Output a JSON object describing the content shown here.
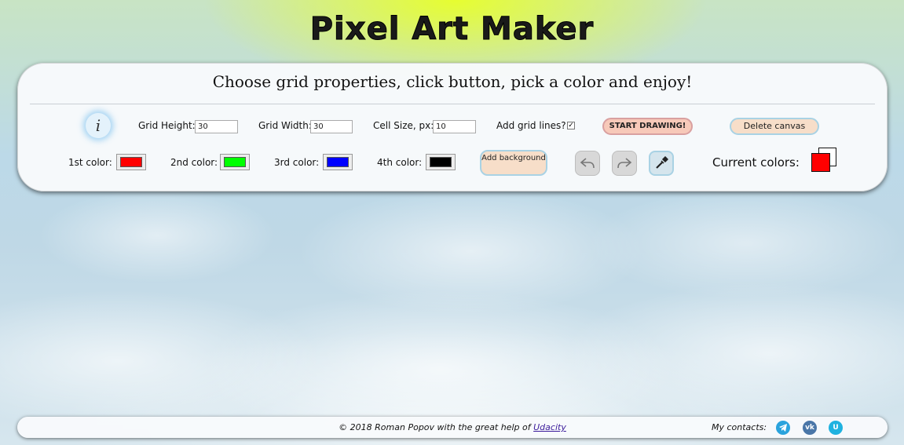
{
  "app": {
    "title": "Pixel Art Maker"
  },
  "panel": {
    "subtitle": "Choose grid properties, click button, pick a color and enjoy!",
    "info_icon": "info-icon",
    "grid_height": {
      "label": "Grid Height:",
      "value": "30"
    },
    "grid_width": {
      "label": "Grid Width:",
      "value": "30"
    },
    "cell_size": {
      "label": "Cell Size, px:",
      "value": "10"
    },
    "grid_lines": {
      "label": "Add grid lines?",
      "checked": true
    },
    "start_label": "START DRAWING!",
    "delete_label": "Delete canvas",
    "colors": [
      {
        "label": "1st color:",
        "value": "#ff0000"
      },
      {
        "label": "2nd color:",
        "value": "#00ff00"
      },
      {
        "label": "3rd color:",
        "value": "#0000ff"
      },
      {
        "label": "4th color:",
        "value": "#000000"
      }
    ],
    "add_background_label": "Add background",
    "undo_icon": "undo-icon",
    "redo_icon": "redo-icon",
    "eyedropper_icon": "eyedropper-icon",
    "current_colors_label": "Current colors:",
    "current_colors": {
      "primary": "#ff0000",
      "secondary": "#ffffff"
    }
  },
  "footer": {
    "copyright_text": "© 2018 Roman Popov with the great help of",
    "link_label": "Udacity",
    "contacts_label": "My contacts:",
    "social": [
      {
        "icon": "telegram-icon",
        "color": "#2aa3dd"
      },
      {
        "icon": "vk-icon",
        "color": "#4a76a8"
      },
      {
        "icon": "udacity-icon",
        "color": "#1fb2e0"
      }
    ]
  }
}
